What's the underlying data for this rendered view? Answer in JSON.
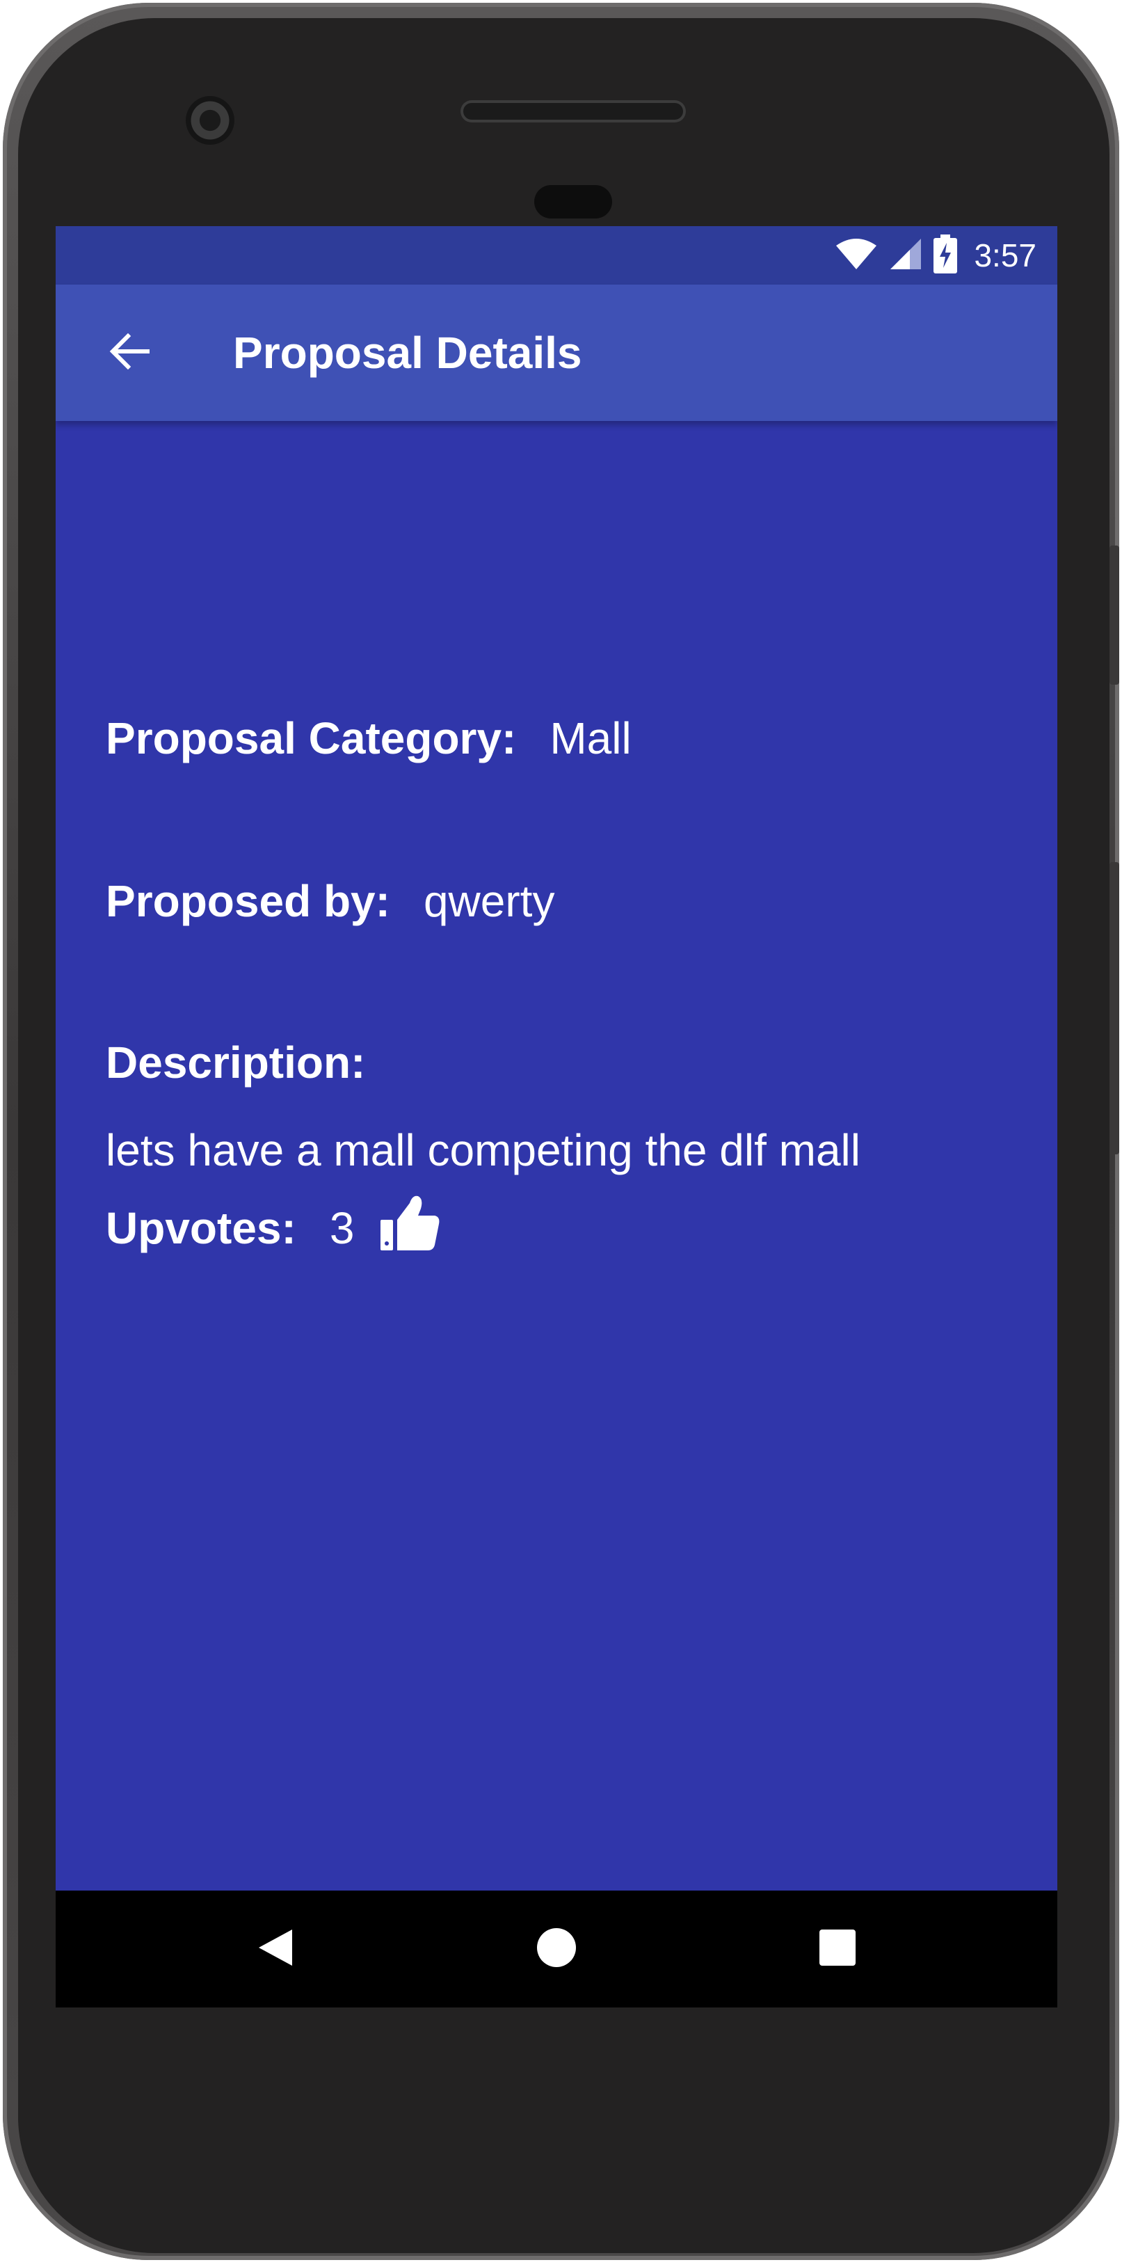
{
  "status_bar": {
    "time": "3:57",
    "icons": [
      "wifi-icon",
      "cell-signal-icon",
      "battery-charging-icon"
    ]
  },
  "app_bar": {
    "title": "Proposal Details",
    "back_icon": "arrow-back-icon"
  },
  "details": {
    "category_label": "Proposal Category:",
    "category_value": "Mall",
    "proposer_label": "Proposed by:",
    "proposer_value": "qwerty",
    "description_label": "Description:",
    "description_value": "lets have a mall competing the dlf mall",
    "upvotes_label": "Upvotes:",
    "upvotes_value": "3",
    "upvote_icon": "thumbs-up-icon"
  },
  "nav_bar": {
    "icons": [
      "nav-back-icon",
      "nav-home-icon",
      "nav-recents-icon"
    ]
  },
  "colors": {
    "screen_background": "#3036aa",
    "app_bar": "#3f51b5",
    "status_bar": "#2e3c99",
    "text": "#ffffff",
    "nav_bar": "#000000"
  }
}
